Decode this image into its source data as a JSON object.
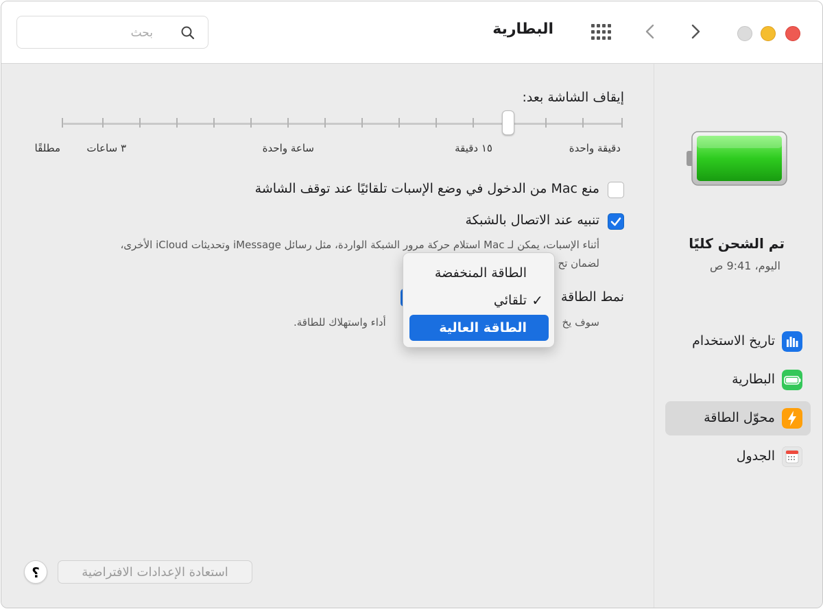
{
  "window": {
    "title": "البطارية"
  },
  "search": {
    "placeholder": "بحث"
  },
  "sidebar": {
    "battery_status": {
      "main": "تم الشحن كليًا",
      "time": "اليوم، 9:41 ص"
    },
    "items": [
      {
        "label": "تاريخ الاستخدام",
        "icon": "bar-chart-icon",
        "color": "#1a73e8"
      },
      {
        "label": "البطارية",
        "icon": "battery-icon",
        "color": "#34c759"
      },
      {
        "label": "محوّل الطاقة",
        "icon": "lightning-icon",
        "color": "#ff9f0a",
        "active": true
      },
      {
        "label": "الجدول",
        "icon": "calendar-icon",
        "color": "#e5e5e5"
      }
    ]
  },
  "display_sleep": {
    "title": "إيقاف الشاشة بعد:",
    "ticks": [
      "دقيقة واحدة",
      "١٥ دقيقة",
      "ساعة واحدة",
      "٣ ساعات",
      "مطلقًا"
    ],
    "selected": "١٥ دقيقة"
  },
  "options": {
    "prevent_sleep": {
      "label": "منع Mac من الدخول في وضع الإسبات تلقائيًا عند توقف الشاشة",
      "checked": false
    },
    "wake_network": {
      "label": "تنبيه عند الاتصال بالشبكة",
      "checked": true
    },
    "wake_network_desc_line1": "أثناء الإسبات، يمكن لـ Mac استلام حركة مرور الشبكة الواردة، مثل رسائل iMessage وتحديثات iCloud الأخرى،",
    "wake_network_desc_line2_visible": "لضمان تح",
    "power_mode_label_visible": "نمط الطاقة",
    "power_mode_desc_right": "سوف يخ",
    "power_mode_desc_left": "أداء واستهلاك للطاقة."
  },
  "power_mode_menu": {
    "items": [
      {
        "label": "الطاقة المنخفضة",
        "checked": false,
        "highlighted": false
      },
      {
        "label": "تلقائي",
        "checked": true,
        "highlighted": false
      },
      {
        "label": "الطاقة العالية",
        "checked": false,
        "highlighted": true
      }
    ],
    "check_glyph": "✓"
  },
  "footer": {
    "restore_label": "استعادة الإعدادات الافتراضية",
    "help_label": "؟"
  }
}
